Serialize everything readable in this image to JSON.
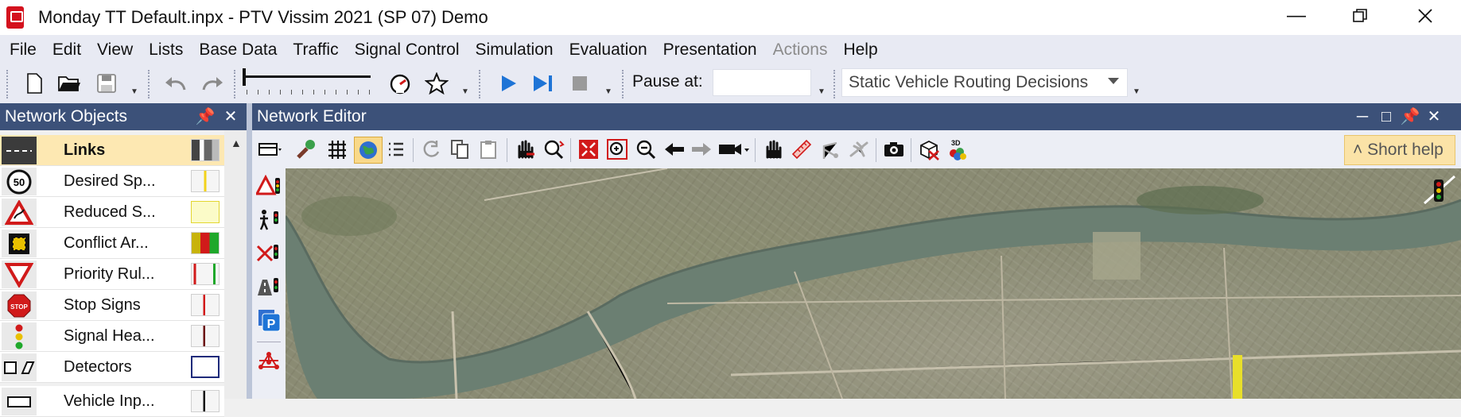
{
  "window": {
    "title": "Monday TT Default.inpx - PTV Vissim 2021 (SP 07) Demo",
    "buttons": [
      "minimize",
      "restore",
      "close"
    ]
  },
  "menu": [
    "File",
    "Edit",
    "View",
    "Lists",
    "Base Data",
    "Traffic",
    "Signal Control",
    "Simulation",
    "Evaluation",
    "Presentation",
    "Actions",
    "Help"
  ],
  "menu_disabled": [
    "Actions"
  ],
  "toolbar": {
    "pause_label": "Pause at:",
    "pause_value": "",
    "routing_select": "Static Vehicle Routing Decisions"
  },
  "network_objects": {
    "title": "Network Objects",
    "items": [
      {
        "label": "Links",
        "icon": "links-icon",
        "swatch": "grey-bars"
      },
      {
        "label": "Desired Sp...",
        "icon": "speed-50-sign-icon",
        "swatch": "#f2d21b"
      },
      {
        "label": "Reduced S...",
        "icon": "warning-triangle-icon",
        "swatch": "#f6f377"
      },
      {
        "label": "Conflict Ar...",
        "icon": "conflict-area-icon",
        "swatch": "red-yellow-green"
      },
      {
        "label": "Priority Rul...",
        "icon": "yield-triangle-icon",
        "swatch": "red-green"
      },
      {
        "label": "Stop Signs",
        "icon": "stop-sign-icon",
        "swatch": "#d11a1a"
      },
      {
        "label": "Signal Hea...",
        "icon": "traffic-light-icon",
        "swatch": "#6b0d0d"
      },
      {
        "label": "Detectors",
        "icon": "detector-icon",
        "swatch": "#1e2a7a"
      },
      {
        "label": "Vehicle Inp...",
        "icon": "vehicle-input-icon",
        "swatch": "#111111"
      }
    ]
  },
  "network_editor": {
    "title": "Network Editor",
    "short_help": "Short help"
  },
  "colors": {
    "panel_header": "#3c5179",
    "menubar": "#e8eaf3",
    "selected_row": "#fde8b2",
    "short_help_bg": "#fbe3a7",
    "play_blue": "#1e74d6"
  }
}
